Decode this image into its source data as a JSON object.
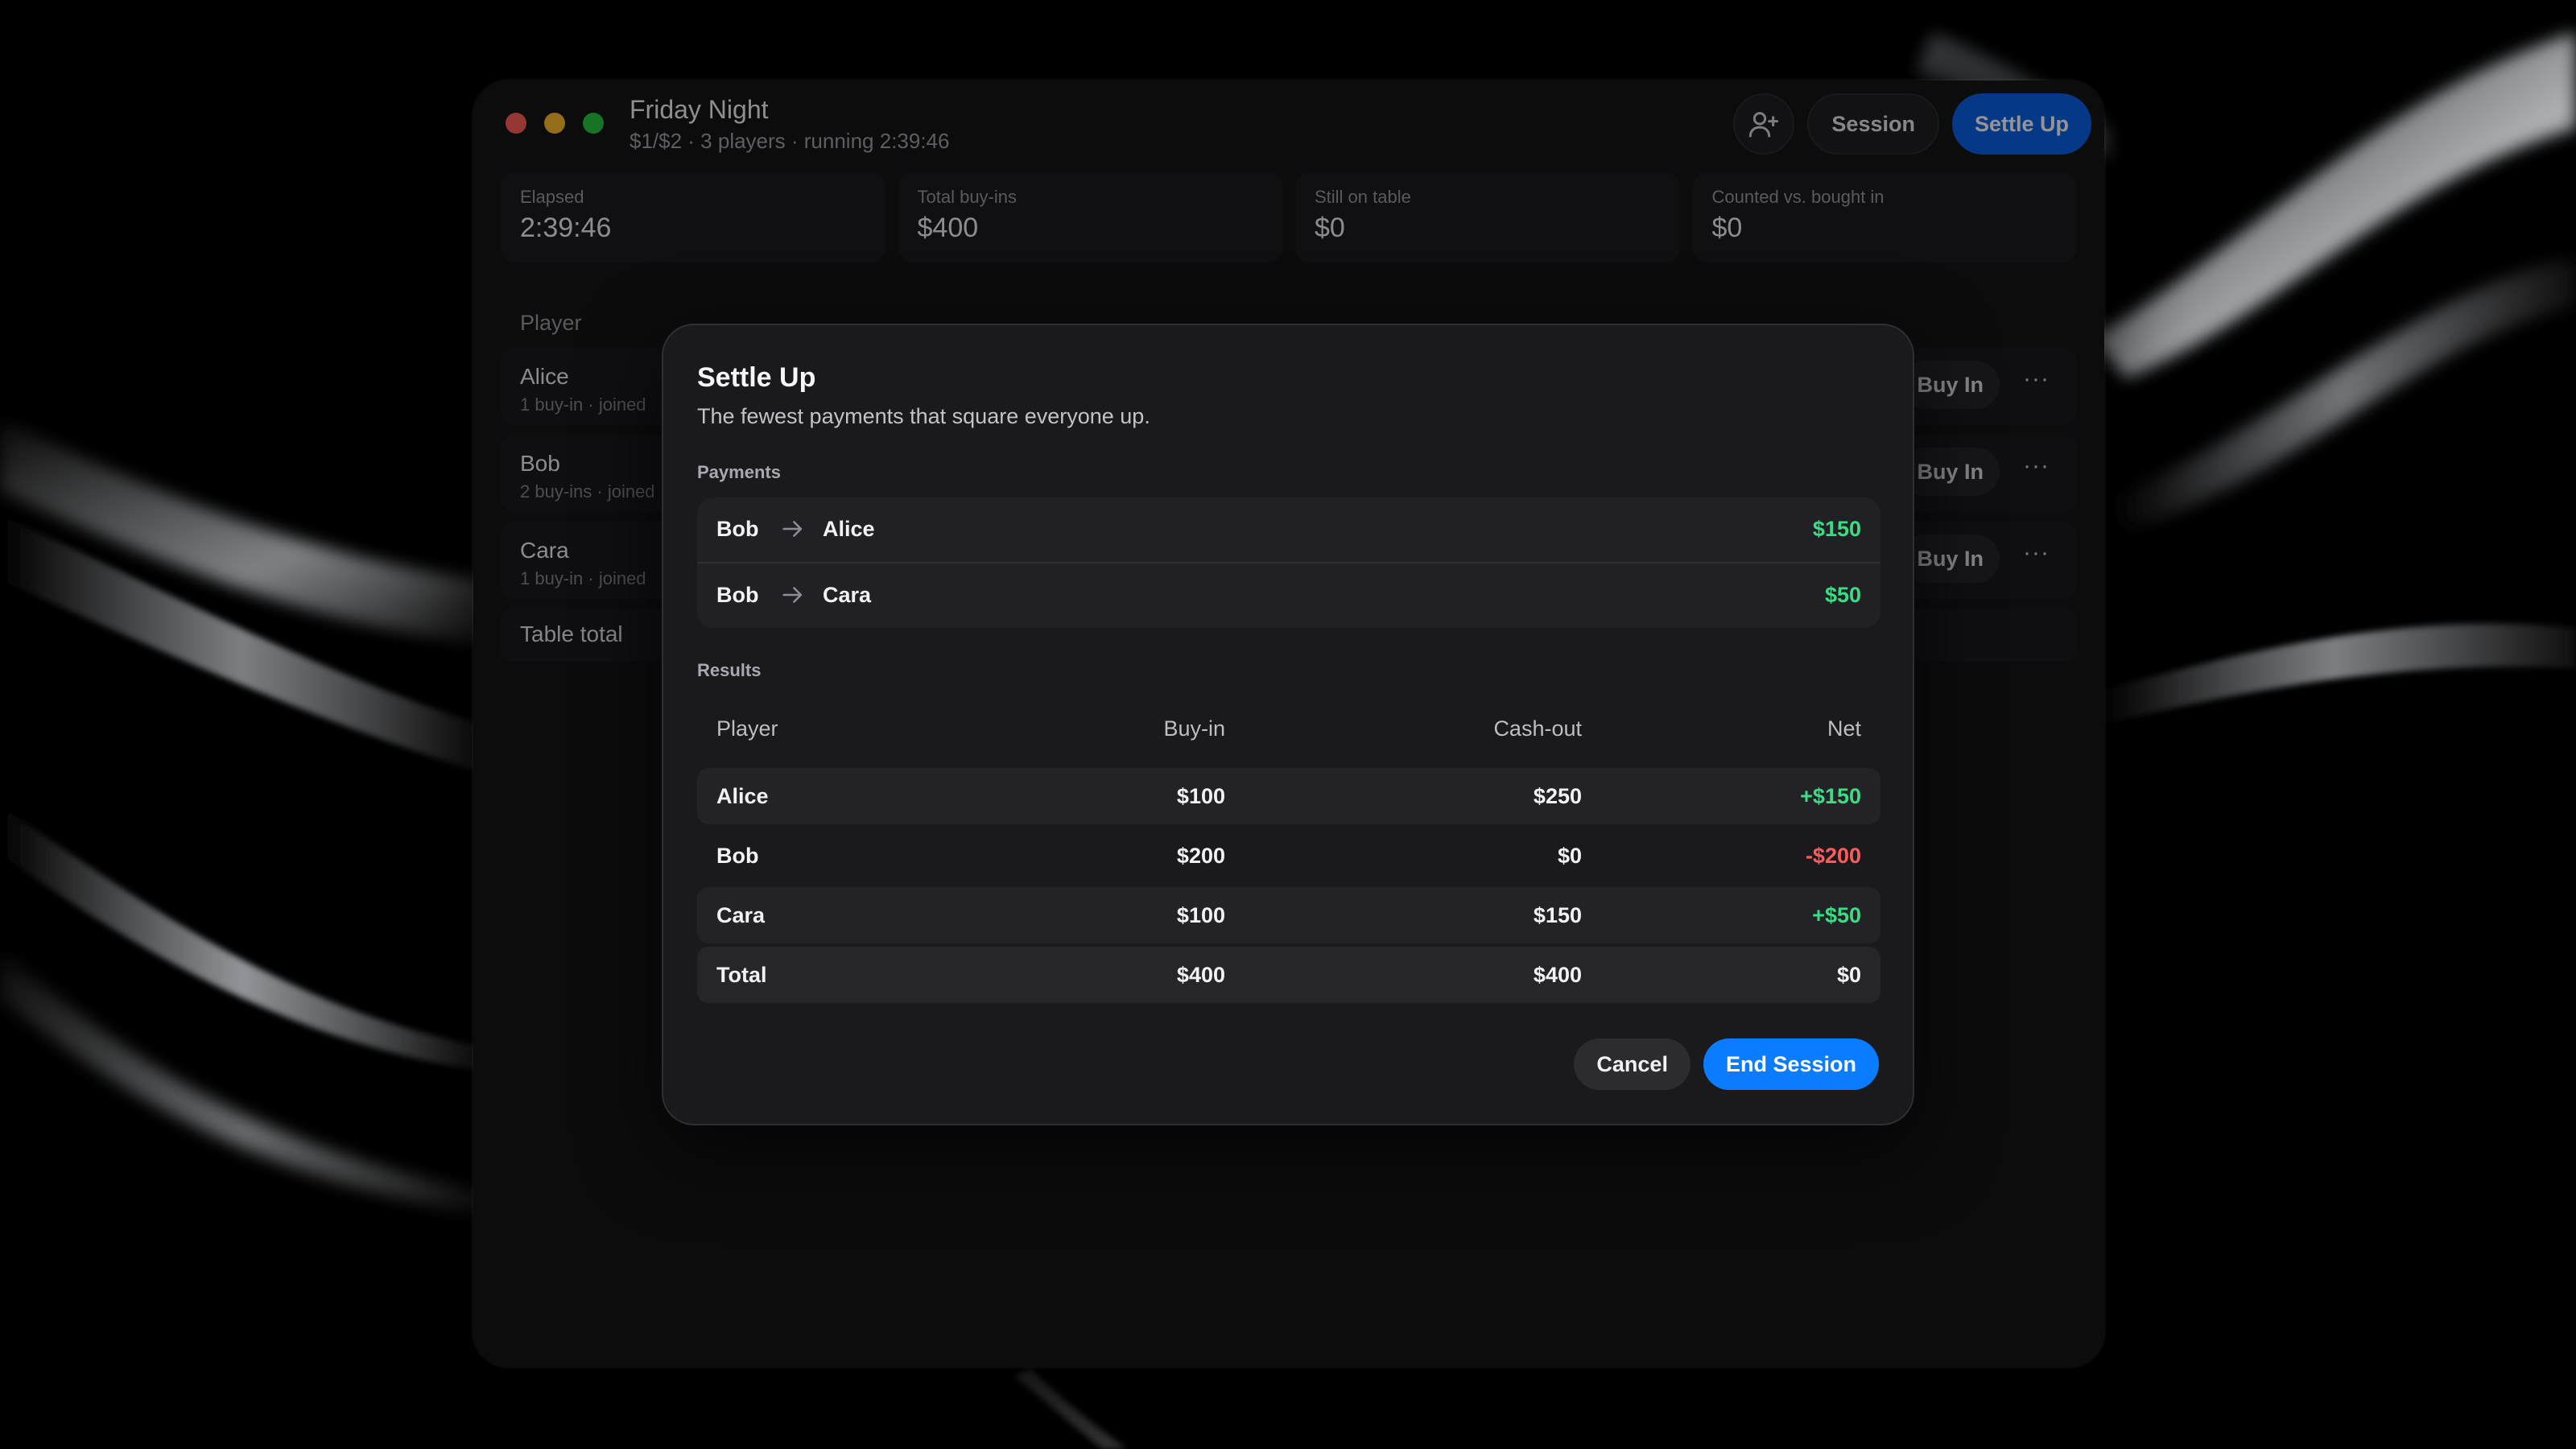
{
  "window": {
    "title": "Friday Night",
    "subtitle": "$1/$2 · 3 players · running 2:39:46"
  },
  "header": {
    "session_label": "Session",
    "settle_label": "Settle Up"
  },
  "stats": [
    {
      "label": "Elapsed",
      "value": "2:39:46"
    },
    {
      "label": "Total buy-ins",
      "value": "$400"
    },
    {
      "label": "Still on table",
      "value": "$0"
    },
    {
      "label": "Counted vs. bought in",
      "value": "$0"
    }
  ],
  "players_table": {
    "header_player": "Player",
    "rows": [
      {
        "name": "Alice",
        "meta": "1 buy-in · joined"
      },
      {
        "name": "Bob",
        "meta": "2 buy-ins · joined"
      },
      {
        "name": "Cara",
        "meta": "1 buy-in · joined"
      }
    ],
    "buy_in_label": "Buy In",
    "more_label": "···",
    "total_label": "Table total"
  },
  "modal": {
    "title": "Settle Up",
    "subtitle": "The fewest payments that square everyone up.",
    "payments_label": "Payments",
    "payments": [
      {
        "from": "Bob",
        "to": "Alice",
        "amount": "$150"
      },
      {
        "from": "Bob",
        "to": "Cara",
        "amount": "$50"
      }
    ],
    "results_label": "Results",
    "results_headers": {
      "player": "Player",
      "buy_in": "Buy-in",
      "cash_out": "Cash-out",
      "net": "Net"
    },
    "results": [
      {
        "player": "Alice",
        "buy_in": "$100",
        "cash_out": "$250",
        "net": "+$150"
      },
      {
        "player": "Bob",
        "buy_in": "$200",
        "cash_out": "$0",
        "net": "-$200"
      },
      {
        "player": "Cara",
        "buy_in": "$100",
        "cash_out": "$150",
        "net": "+$50"
      }
    ],
    "total": {
      "player": "Total",
      "buy_in": "$400",
      "cash_out": "$400",
      "net": "$0"
    },
    "cancel_label": "Cancel",
    "end_label": "End Session"
  },
  "colors": {
    "accent": "#0a7cff",
    "positive": "#3ddc84",
    "negative": "#ff5b5b"
  }
}
